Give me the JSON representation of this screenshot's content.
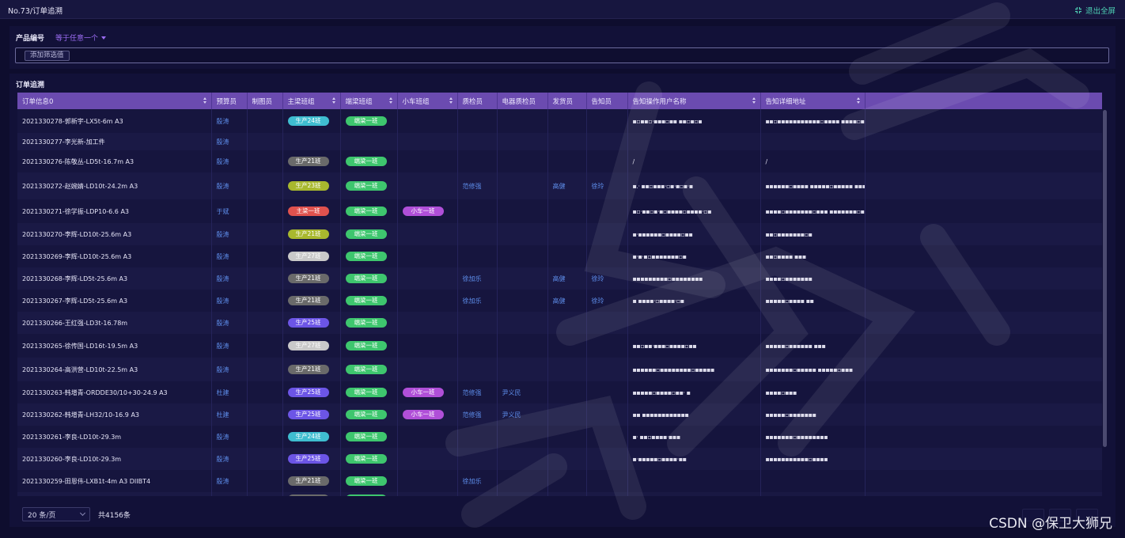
{
  "window": {
    "title": "No.73/订单追溯",
    "exit_fullscreen": "退出全屏"
  },
  "filter": {
    "field_label": "产品编号",
    "operator": "等于任意一个",
    "add_filter": "添加筛选值"
  },
  "table": {
    "section_title": "订单追溯",
    "columns": [
      {
        "label": "订单信息0",
        "sortable": true
      },
      {
        "label": "预算员",
        "sortable": false
      },
      {
        "label": "制图员",
        "sortable": false
      },
      {
        "label": "主梁班组",
        "sortable": true
      },
      {
        "label": "端梁班组",
        "sortable": true
      },
      {
        "label": "小车班组",
        "sortable": true
      },
      {
        "label": "质检员",
        "sortable": false
      },
      {
        "label": "电器质检员",
        "sortable": false
      },
      {
        "label": "发货员",
        "sortable": false
      },
      {
        "label": "告知员",
        "sortable": false
      },
      {
        "label": "告知操作用户名称",
        "sortable": true
      },
      {
        "label": "告知详细地址",
        "sortable": true
      },
      {
        "label": "",
        "sortable": false
      }
    ],
    "rows": [
      {
        "order": "2021330278-郭新宇-LX5t-6m A3",
        "budget": "殷涛",
        "main": {
          "text": "生产24班",
          "color": "#3fbdd0"
        },
        "end": {
          "text": "端梁一班",
          "color": "#3ec66e"
        },
        "cart": null,
        "qc": "",
        "eqc": "",
        "ship": "",
        "notify": "",
        "user": "▪▫▪▪▫·▪▪▪▫▪▪ ▪▪▫▪▫▪",
        "addr": "▪▪▫▪▪▪▪▪▪▪▪▪▪▪▫▪▪▪▪ ▪▪▪▪▫▪▪▪▪▫▪▪▪▪",
        "h": 30
      },
      {
        "order": "2021330277-李光新-加工件",
        "budget": "殷涛",
        "main": null,
        "end": null,
        "cart": null,
        "qc": "",
        "eqc": "",
        "ship": "",
        "notify": "",
        "user": "",
        "addr": "",
        "h": 22
      },
      {
        "order": "2021330276-陈敬丛-LD5t-16.7m A3",
        "budget": "殷涛",
        "main": {
          "text": "生产21班",
          "color": "#6a6a6a"
        },
        "end": {
          "text": "端梁一班",
          "color": "#3ec66e"
        },
        "cart": null,
        "qc": "",
        "eqc": "",
        "ship": "",
        "notify": "",
        "user": "/",
        "addr": "/",
        "h": 28
      },
      {
        "order": "2021330272-赵婉婧-LD10t-24.2m A3",
        "budget": "殷涛",
        "main": {
          "text": "生产23班",
          "color": "#a8b82e"
        },
        "end": {
          "text": "端梁一班",
          "color": "#3ec66e"
        },
        "cart": null,
        "qc": "范修强",
        "eqc": "",
        "ship": "高健",
        "notify": "徐玲",
        "user": "▪.· ▪▪▫▪▪▪·▫▪·▪▫▪·▪",
        "addr": "▪▪▪▪▪▪▫▪▪▪▪ ▪▪▪▪▪▫▪▪▪▪▪ ▪▪▪▪▪▪▫▪",
        "h": 34
      },
      {
        "order": "2021330271-徐学振-LDP10-6.6 A3",
        "budget": "于斌",
        "main": {
          "text": "主梁一班",
          "color": "#e0524e"
        },
        "end": {
          "text": "端梁一班",
          "color": "#3ec66e"
        },
        "cart": {
          "text": "小车一班",
          "color": "#b04fd8"
        },
        "qc": "",
        "eqc": "",
        "ship": "",
        "notify": "",
        "user": "▪▫·▪▪▫▪·▪▫▪▪▪▪▫▪▪▪▪·▫▪",
        "addr": "▪▪▪▪▫▪▪▪▪▪▪▪▫▪▪▪ ▪▪▪▪▪▪▪▫▪▪▪▪",
        "h": 30
      },
      {
        "order": "2021330270-李辉-LD10t-25.6m A3",
        "budget": "殷涛",
        "main": {
          "text": "生产21班",
          "color": "#a8b82e"
        },
        "end": {
          "text": "端梁一班",
          "color": "#3ec66e"
        },
        "cart": null,
        "qc": "",
        "eqc": "",
        "ship": "",
        "notify": "",
        "user": "▪·▪▪▪▪▪▪▫▪▪▪▪▫▪▪",
        "addr": "▪▪▫▪▪▪▪▪▪▪▫▪",
        "h": 28
      },
      {
        "order": "2021330269-李辉-LD10t-25.6m A3",
        "budget": "殷涛",
        "main": {
          "text": "生产27班",
          "color": "#c9c9c9"
        },
        "end": {
          "text": "端梁一班",
          "color": "#3ec66e"
        },
        "cart": null,
        "qc": "",
        "eqc": "",
        "ship": "",
        "notify": "",
        "user": "▪·▪·▪▫▪▪▪▪▪▪▪▫▪",
        "addr": "▪▪▫▪▪▪▪ ▪▪▪",
        "h": 28
      },
      {
        "order": "2021330268-李辉-LD5t-25.6m A3",
        "budget": "殷涛",
        "main": {
          "text": "生产21班",
          "color": "#6a6a6a"
        },
        "end": {
          "text": "端梁一班",
          "color": "#3ec66e"
        },
        "cart": null,
        "qc": "徐加乐",
        "eqc": "",
        "ship": "高健",
        "notify": "徐玲",
        "user": "▪▪▪▪▪▪▪▪▪▫▪▪▪▪▪▪▪▪",
        "addr": "▪▪▪▪▫▪▪▪▪▪▪▪",
        "h": 28
      },
      {
        "order": "2021330267-李辉-LD5t-25.6m A3",
        "budget": "殷涛",
        "main": {
          "text": "生产21班",
          "color": "#6a6a6a"
        },
        "end": {
          "text": "端梁一班",
          "color": "#3ec66e"
        },
        "cart": null,
        "qc": "徐加乐",
        "eqc": "",
        "ship": "高健",
        "notify": "徐玲",
        "user": "▪  ▪▪▪▪·▫▪▪▪▪·▫▪",
        "addr": "▪▪▪▪▪▫▪▪▪▪ ▪▪",
        "h": 28
      },
      {
        "order": "2021330266-王红强-LD3t-16.78m",
        "budget": "殷涛",
        "main": {
          "text": "生产25班",
          "color": "#6c55e6"
        },
        "end": {
          "text": "端梁一班",
          "color": "#3ec66e"
        },
        "cart": null,
        "qc": "",
        "eqc": "",
        "ship": "",
        "notify": "",
        "user": "",
        "addr": "",
        "h": 28
      },
      {
        "order": "2021330265-徐传国-LD16t-19.5m A3",
        "budget": "殷涛",
        "main": {
          "text": "生产27班",
          "color": "#c9c9c9"
        },
        "end": {
          "text": "端梁一班",
          "color": "#3ec66e"
        },
        "cart": null,
        "qc": "",
        "eqc": "",
        "ship": "",
        "notify": "",
        "user": "▪▪▫▪▪·▪▪▪▫▪▪▪▪▫▪▪",
        "addr": "▪▪▪▪▪▫▪▪▪▪▪▪ ▪▪▪",
        "h": 30
      },
      {
        "order": "2021330264-高洪营-LD10t-22.5m A3",
        "budget": "殷涛",
        "main": {
          "text": "生产21班",
          "color": "#6a6a6a"
        },
        "end": {
          "text": "端梁一班",
          "color": "#3ec66e"
        },
        "cart": null,
        "qc": "",
        "eqc": "",
        "ship": "",
        "notify": "",
        "user": "▪▪▪▪▪▪▫▪▪▪▪▪▪▪▪▫▪▪▪▪▪",
        "addr": "▪▪▪▪▪▪▪▫▪▪▪▪▪ ▪▪▪▪▪▫▪▪▪",
        "h": 30
      },
      {
        "order": "2021330263-韩增青-ORDDE30/10+30-24.9 A3",
        "budget": "杜建",
        "main": {
          "text": "生产25班",
          "color": "#6c55e6"
        },
        "end": {
          "text": "端梁一班",
          "color": "#3ec66e"
        },
        "cart": {
          "text": "小车一班",
          "color": "#b04fd8"
        },
        "qc": "范修强",
        "eqc": "尹义民",
        "ship": "",
        "notify": "",
        "user": "▪▪▪▪▪▫▪▪▪▪▫▪▪· ▪",
        "addr": "▪▪▪▪▫▪▪▪",
        "h": 28
      },
      {
        "order": "2021330262-韩增青-LH32/10-16.9 A3",
        "budget": "杜建",
        "main": {
          "text": "生产25班",
          "color": "#6c55e6"
        },
        "end": {
          "text": "端梁一班",
          "color": "#3ec66e"
        },
        "cart": {
          "text": "小车一班",
          "color": "#b04fd8"
        },
        "qc": "范修强",
        "eqc": "尹义民",
        "ship": "",
        "notify": "",
        "user": "▪▪ ▪▪▪▪▪▪▪▪▪▪▪▪",
        "addr": "▪▪▪▪▪▫▪▪▪▪▪▪▪",
        "h": 28
      },
      {
        "order": "2021330261-李良-LD10t-29.3m",
        "budget": "殷涛",
        "main": {
          "text": "生产24班",
          "color": "#3fbdd0"
        },
        "end": {
          "text": "端梁一班",
          "color": "#3ec66e"
        },
        "cart": null,
        "qc": "",
        "eqc": "",
        "ship": "",
        "notify": "",
        "user": "▪· ▪▪▫▪▪▪▪·▪▪▪",
        "addr": "▪▪▪▪▪▪▪▫▪▪▪▪▪▪▪▪",
        "h": 28
      },
      {
        "order": "2021330260-李良-LD10t-29.3m",
        "budget": "殷涛",
        "main": {
          "text": "生产25班",
          "color": "#6c55e6"
        },
        "end": {
          "text": "端梁一班",
          "color": "#3ec66e"
        },
        "cart": null,
        "qc": "",
        "eqc": "",
        "ship": "",
        "notify": "",
        "user": "▪·▪▪▪▪▪▫▪▪▪▪·▪▪",
        "addr": "▪▪▪▪▪▪▪▪▪▪▪▫▪▪▪▪",
        "h": 28
      },
      {
        "order": "2021330259-田恩伟-LXB1t-4m A3 DIIBT4",
        "budget": "殷涛",
        "main": {
          "text": "生产21班",
          "color": "#6a6a6a"
        },
        "end": {
          "text": "端梁一班",
          "color": "#3ec66e"
        },
        "cart": null,
        "qc": "徐加乐",
        "eqc": "",
        "ship": "",
        "notify": "",
        "user": "",
        "addr": "",
        "h": 28
      },
      {
        "order": "",
        "budget": "",
        "main": {
          "text": "",
          "color": "#6a6a6a"
        },
        "end": {
          "text": "",
          "color": "#3ec66e"
        },
        "cart": null,
        "qc": "",
        "eqc": "",
        "ship": "",
        "notify": "",
        "user": "",
        "addr": "",
        "h": 20
      }
    ]
  },
  "pager": {
    "page_size": "20 条/页",
    "total": "共4156条"
  },
  "watermark": {
    "text": "CSDN @保卫大狮兄"
  }
}
